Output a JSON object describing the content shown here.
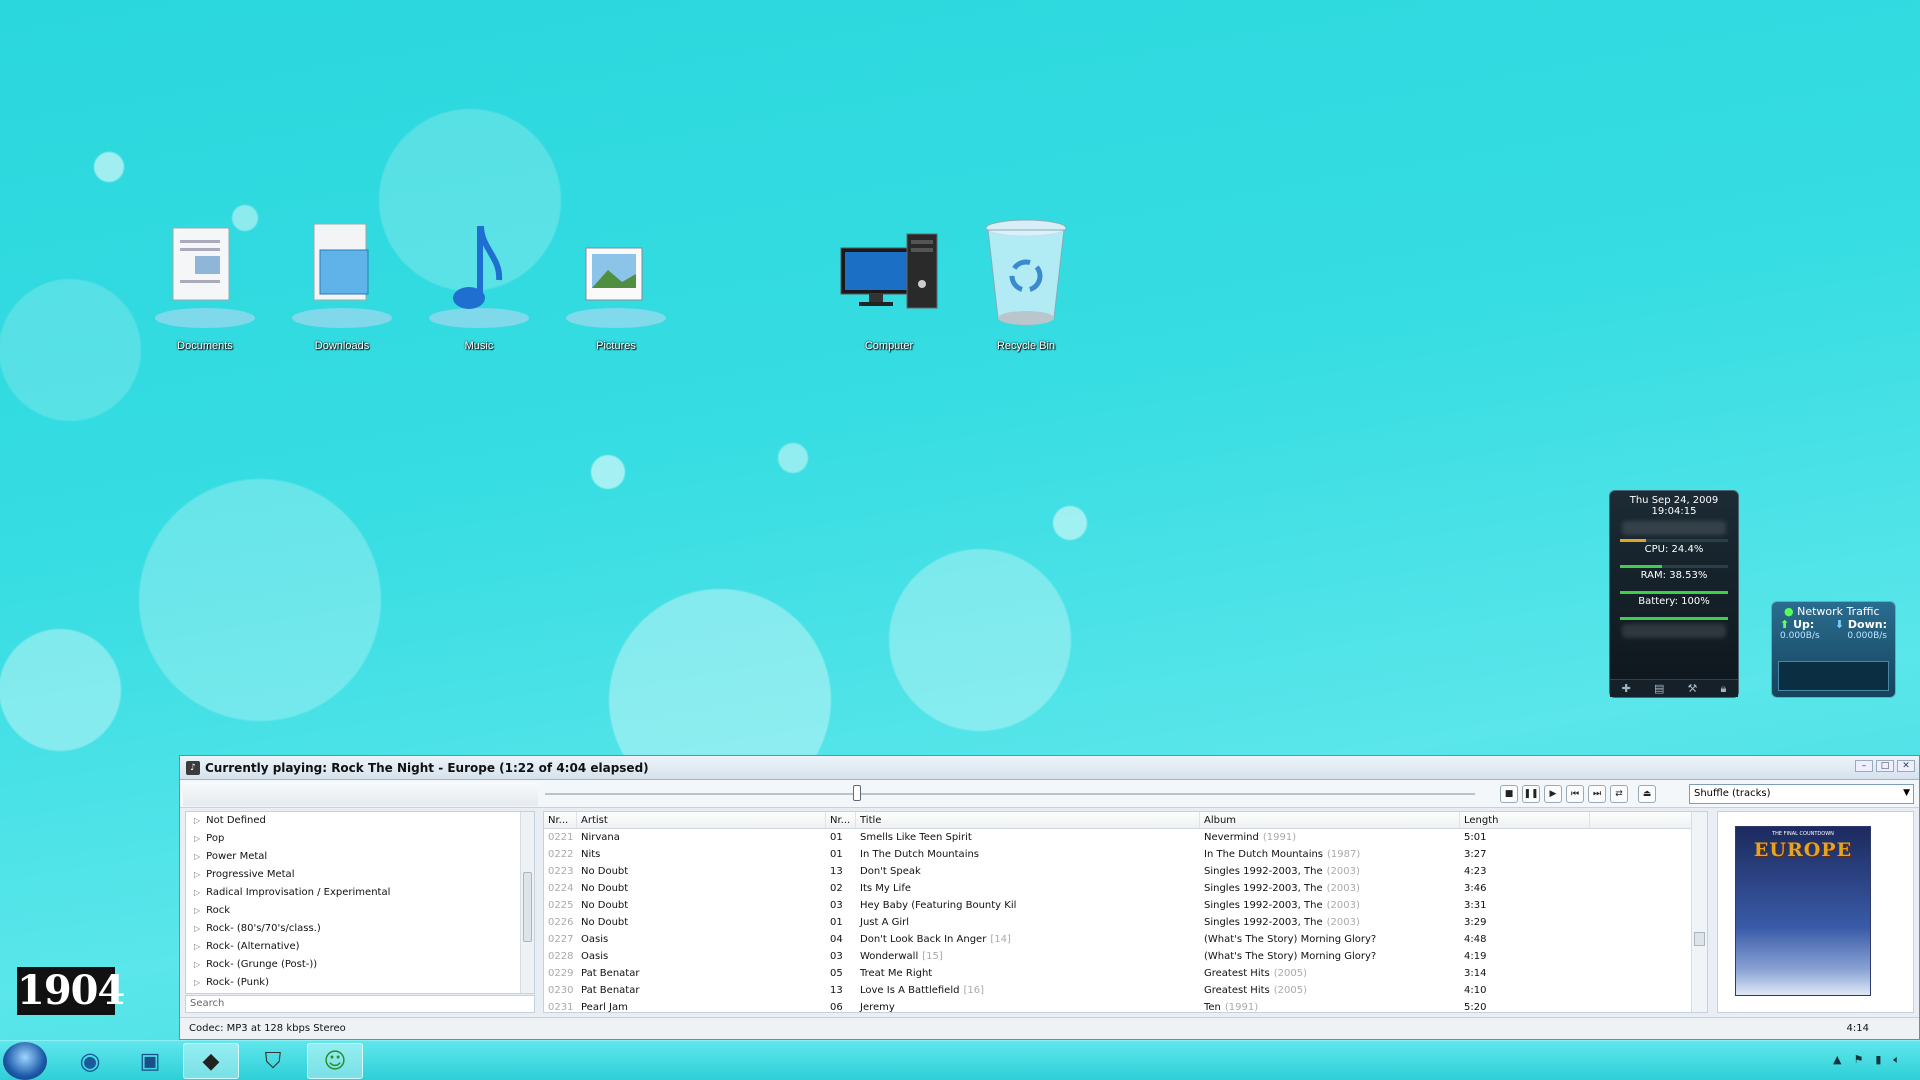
{
  "desktop": {
    "icons": [
      {
        "label": "Documents"
      },
      {
        "label": "Downloads"
      },
      {
        "label": "Music"
      },
      {
        "label": "Pictures"
      },
      {
        "label": "Computer"
      },
      {
        "label": "Recycle Bin"
      }
    ]
  },
  "gadget": {
    "date": "Thu Sep 24, 2009",
    "time": "19:04:15",
    "cpu": "CPU: 24.4%",
    "cpu_level": 0.244,
    "ram": "RAM: 38.53%",
    "ram_level": 0.385,
    "battery": "Battery: 100%",
    "battery_level": 1.0
  },
  "network": {
    "title": "Network Traffic",
    "up_label": "Up:",
    "down_label": "Down:",
    "up_value": "0.000B/s",
    "down_value": "0.000B/s"
  },
  "player": {
    "title": "Currently playing: Rock The Night - Europe (1:22 of 4:04 elapsed)",
    "playback_progress": 0.336,
    "order_mode": "Shuffle (tracks)",
    "tree_items": [
      "Not Defined",
      "Pop",
      "Power Metal",
      "Progressive Metal",
      "Radical Improvisation / Experimental",
      "Rock",
      "Rock- (80's/70's/class.)",
      "Rock- (Alternative)",
      "Rock- (Grunge (Post-))",
      "Rock- (Punk)"
    ],
    "search_placeholder": "Search",
    "columns": {
      "num": "Nr...",
      "artist": "Artist",
      "track": "Nr...",
      "title": "Title",
      "album": "Album",
      "length": "Length"
    },
    "rows": [
      {
        "num": "0221",
        "artist": "Nirvana",
        "track": "01",
        "title": "Smells Like Teen Spirit",
        "title_extra": "",
        "album": "Nevermind",
        "year": "(1991)",
        "length": "5:01"
      },
      {
        "num": "0222",
        "artist": "Nits",
        "track": "01",
        "title": "In The Dutch Mountains",
        "title_extra": "",
        "album": "In The Dutch Mountains",
        "year": "(1987)",
        "length": "3:27"
      },
      {
        "num": "0223",
        "artist": "No Doubt",
        "track": "13",
        "title": "Don't Speak",
        "title_extra": "",
        "album": "Singles 1992-2003, The",
        "year": "(2003)",
        "length": "4:23"
      },
      {
        "num": "0224",
        "artist": "No Doubt",
        "track": "02",
        "title": "Its My Life",
        "title_extra": "",
        "album": "Singles 1992-2003, The",
        "year": "(2003)",
        "length": "3:46"
      },
      {
        "num": "0225",
        "artist": "No Doubt",
        "track": "03",
        "title": "Hey Baby (Featuring Bounty Kil",
        "title_extra": "",
        "album": "Singles 1992-2003, The",
        "year": "(2003)",
        "length": "3:31"
      },
      {
        "num": "0226",
        "artist": "No Doubt",
        "track": "01",
        "title": "Just A Girl",
        "title_extra": "",
        "album": "Singles 1992-2003, The",
        "year": "(2003)",
        "length": "3:29"
      },
      {
        "num": "0227",
        "artist": "Oasis",
        "track": "04",
        "title": "Don't Look Back In Anger",
        "title_extra": "[14]",
        "album": "(What's The Story) Morning Glory?",
        "year": "",
        "length": "4:48"
      },
      {
        "num": "0228",
        "artist": "Oasis",
        "track": "03",
        "title": "Wonderwall",
        "title_extra": "[15]",
        "album": "(What's The Story) Morning Glory?",
        "year": "",
        "length": "4:19"
      },
      {
        "num": "0229",
        "artist": "Pat Benatar",
        "track": "05",
        "title": "Treat Me Right",
        "title_extra": "",
        "album": "Greatest Hits",
        "year": "(2005)",
        "length": "3:14"
      },
      {
        "num": "0230",
        "artist": "Pat Benatar",
        "track": "13",
        "title": "Love Is A Battlefield",
        "title_extra": "[16]",
        "album": "Greatest Hits",
        "year": "(2005)",
        "length": "4:10"
      },
      {
        "num": "0231",
        "artist": "Pearl Jam",
        "track": "06",
        "title": "Jeremy",
        "title_extra": "",
        "album": "Ten",
        "year": "(1991)",
        "length": "5:20"
      }
    ],
    "album_art": {
      "band": "EUROPE",
      "subtitle": "THE FINAL COUNTDOWN"
    },
    "status": "Codec: MP3 at 128 kbps Stereo",
    "status_time": "4:14"
  },
  "overlay_number": "1904"
}
